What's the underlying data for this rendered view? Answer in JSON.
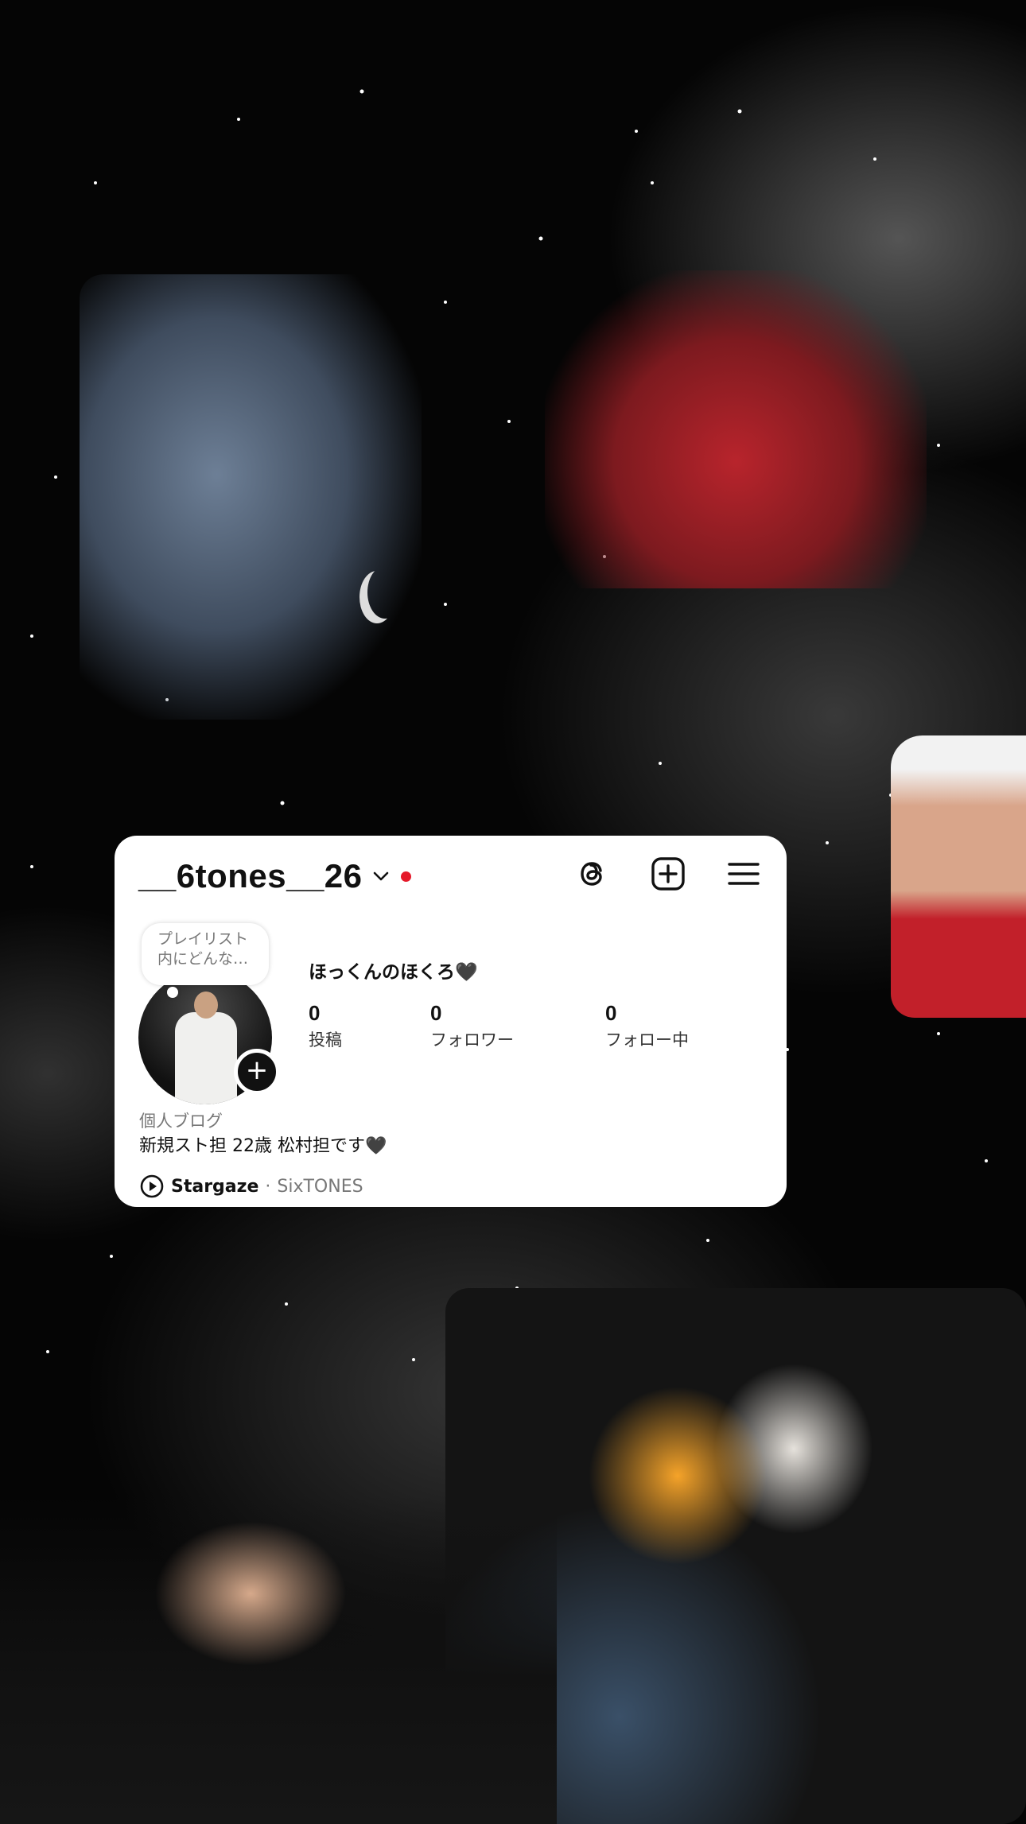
{
  "profile": {
    "username": "__6tones__26",
    "display_name": "ほっくんのほくろ🖤",
    "note_bubble": [
      "プレイリスト",
      "内にどんな…"
    ],
    "stats": [
      {
        "count": "0",
        "label": "投稿"
      },
      {
        "count": "0",
        "label": "フォロワー"
      },
      {
        "count": "0",
        "label": "フォロー中"
      }
    ],
    "category": "個人ブログ",
    "bio": "新規スト担 22歳 松村担です🖤",
    "music": {
      "title": "Stargaze",
      "separator": "·",
      "artist": "SixTONES"
    },
    "add_badge": "+"
  },
  "icons": {
    "dropdown": "chevron-down-icon",
    "notification_dot": "red-dot-badge",
    "threads": "threads-icon",
    "create": "plus-square-icon",
    "menu": "hamburger-menu-icon",
    "play": "play-circle-icon"
  },
  "colors": {
    "accent_red": "#e5192a",
    "card_bg": "#ffffff",
    "background": "#050505"
  }
}
